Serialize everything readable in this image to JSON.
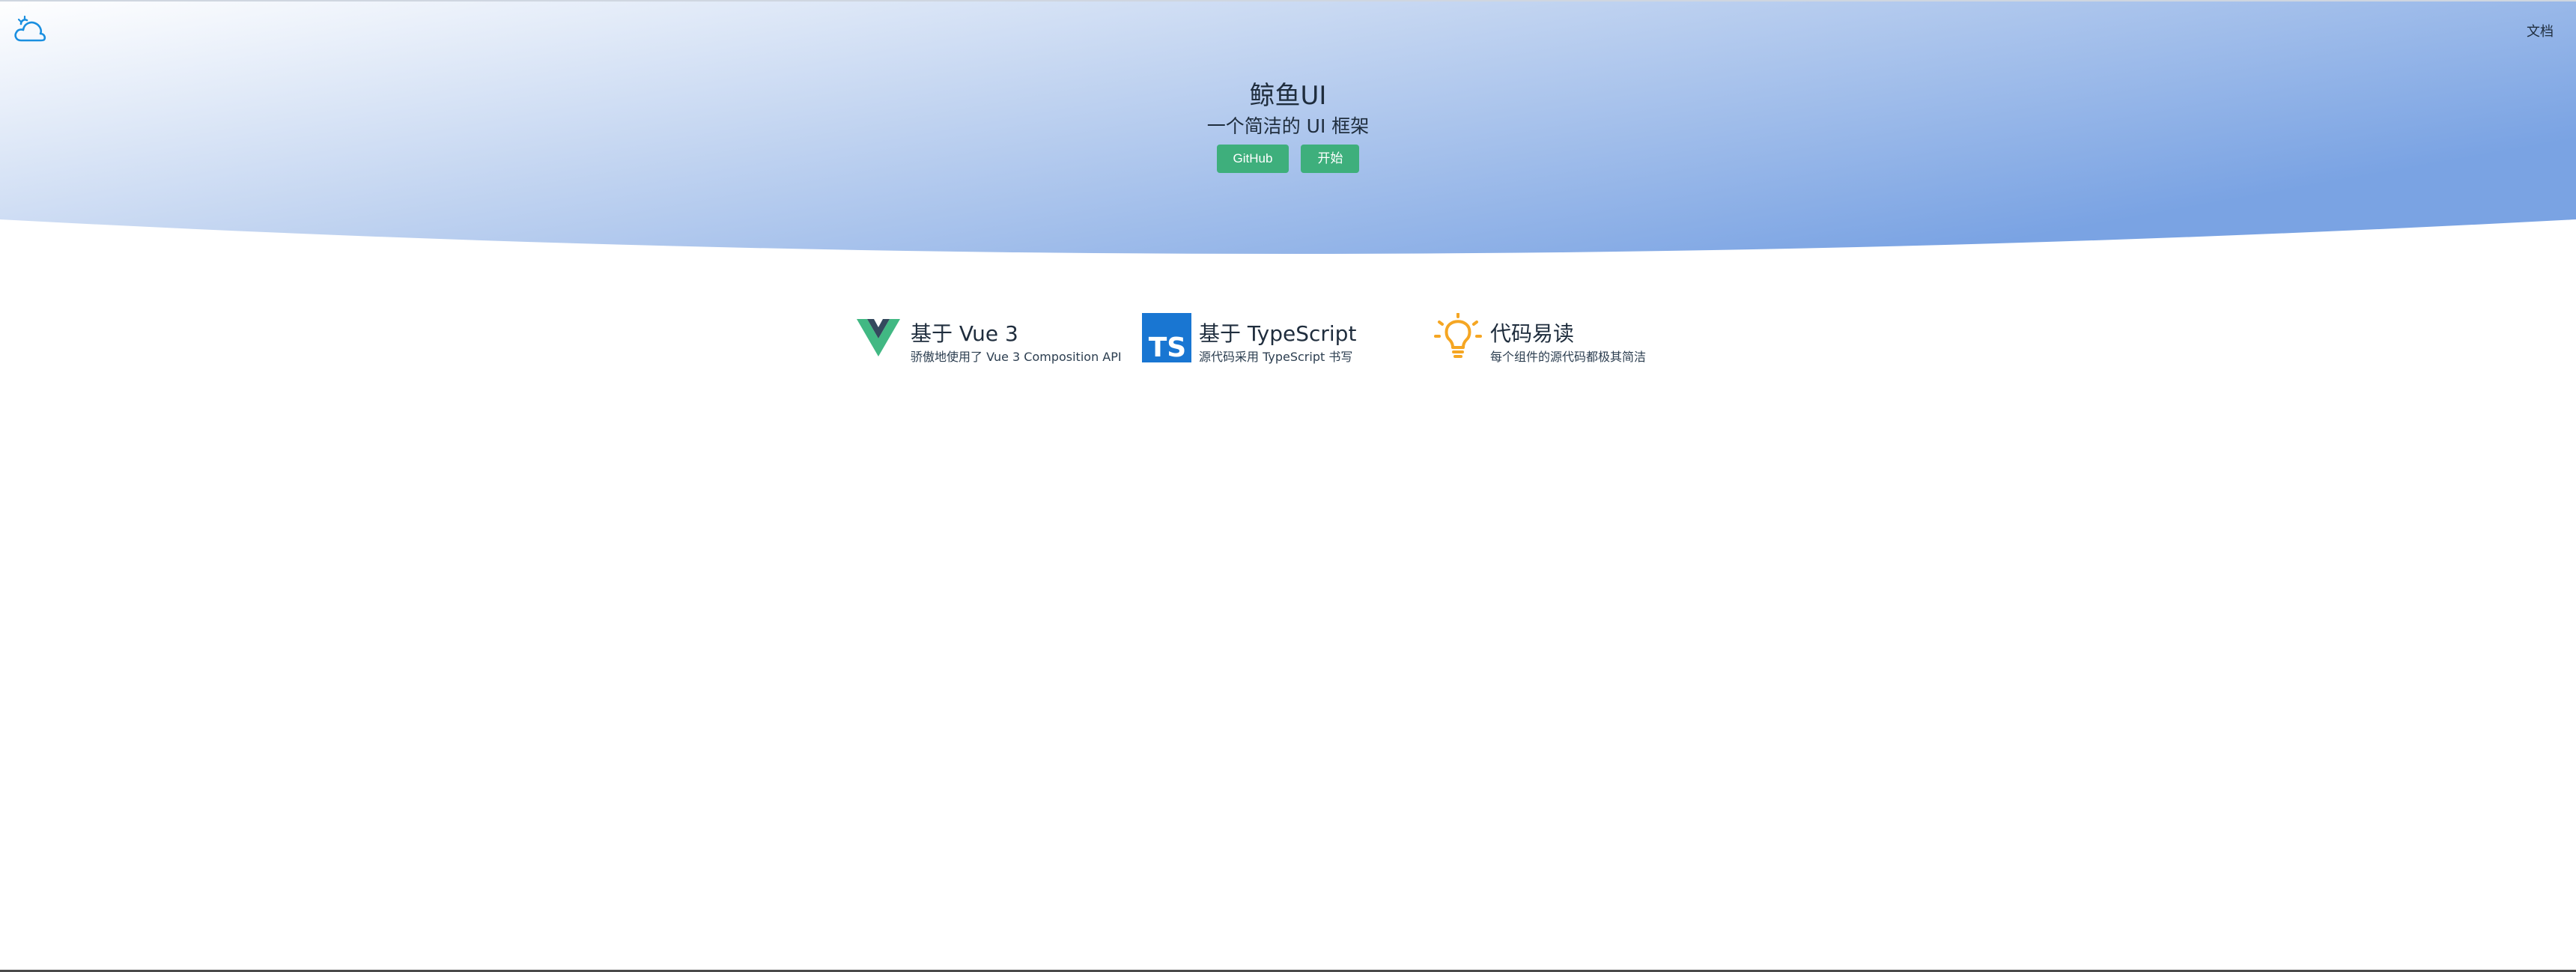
{
  "nav": {
    "logo_icon": "cloud-icon",
    "docs_label": "文档"
  },
  "hero": {
    "title": "鲸鱼UI",
    "subtitle": "一个简洁的 UI 框架",
    "buttons": [
      {
        "label": "GitHub"
      },
      {
        "label": "开始"
      }
    ],
    "gradient": [
      "#ffffff",
      "#c8d8f2",
      "#7fa6e4"
    ],
    "accent": "#3eaf7c"
  },
  "features": [
    {
      "icon": "vue-logo-icon",
      "title": "基于 Vue 3",
      "desc": "骄傲地使用了 Vue 3 Composition API"
    },
    {
      "icon": "typescript-logo-icon",
      "title": "基于 TypeScript",
      "desc": "源代码采用 TypeScript 书写"
    },
    {
      "icon": "lightbulb-icon",
      "title": "代码易读",
      "desc": "每个组件的源代码都极其简洁"
    }
  ]
}
